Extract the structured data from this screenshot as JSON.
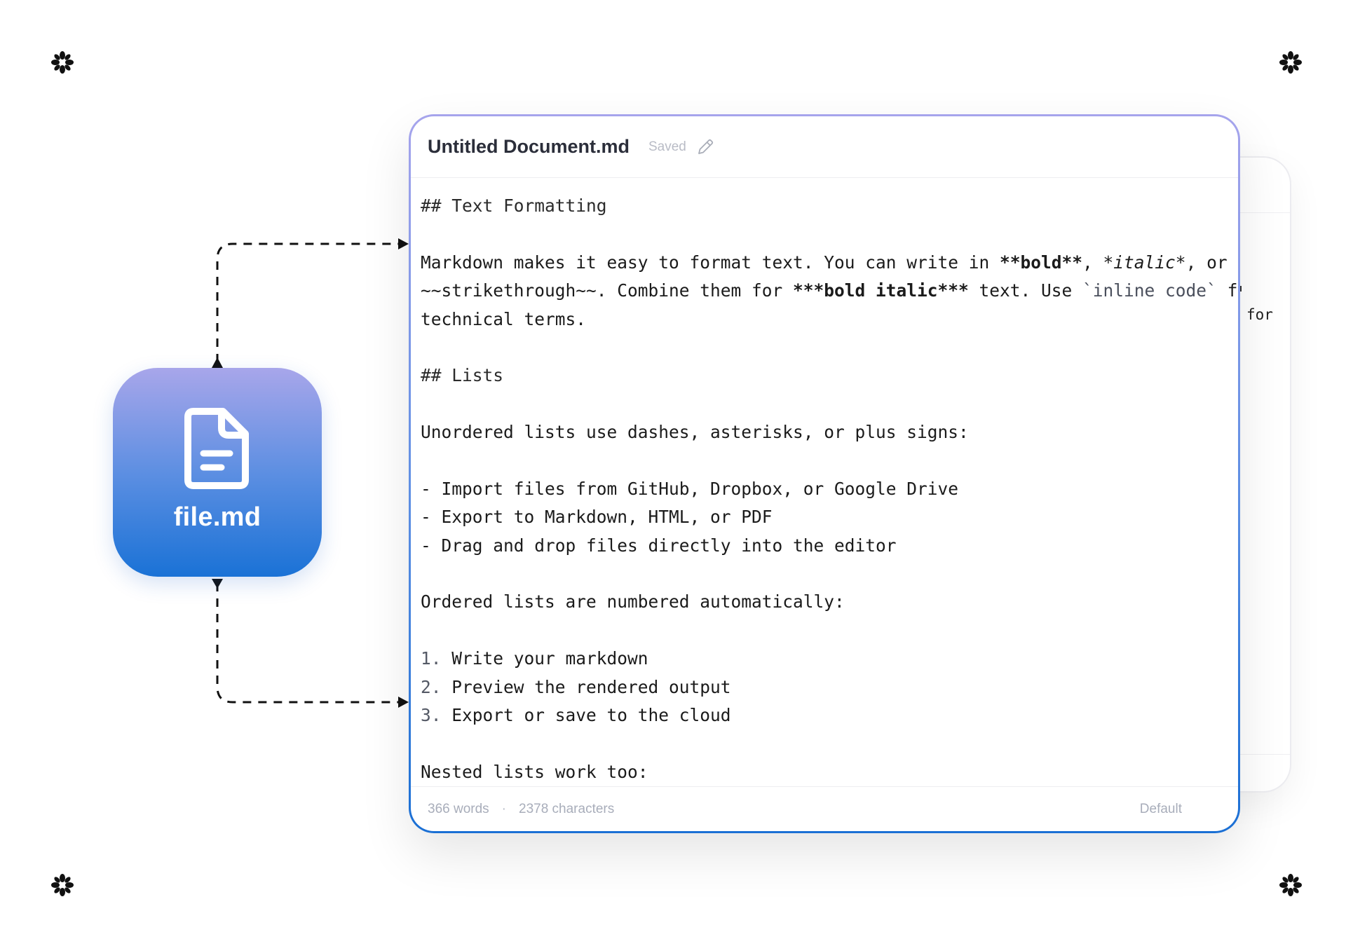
{
  "file_tile": {
    "name": "file.md",
    "icon": "document-icon"
  },
  "editor": {
    "title": "Untitled Document.md",
    "status": "Saved",
    "edit_icon": "pencil-icon",
    "lines": {
      "l1": "## Text Formatting",
      "l2a": "Markdown makes it easy to format text. You can write in ",
      "l2b": "**bold**",
      "l2c": ", ",
      "l2d": "*italic*",
      "l2e": ", or",
      "l3a": "~~strikethrough~~. Combine them for ",
      "l3b": "***bold italic***",
      "l3c": " text. Use ",
      "l3d": "`inline code`",
      "l3e": " for",
      "l4": "technical terms.",
      "l5": "## Lists",
      "l6": "Unordered lists use dashes, asterisks, or plus signs:",
      "l7": "- Import files from GitHub, Dropbox, or Google Drive",
      "l8": "- Export to Markdown, HTML, or PDF",
      "l9": "- Drag and drop files directly into the editor",
      "l10": "Ordered lists are numbered automatically:",
      "ol1_num": "1.",
      "ol1_text": " Write your markdown",
      "ol2_num": "2.",
      "ol2_text": " Preview the rendered output",
      "ol3_num": "3.",
      "ol3_text": " Export or save to the cloud",
      "l11": "Nested lists work too:"
    },
    "footer": {
      "words": "366 words",
      "separator": "·",
      "characters": "2378 characters",
      "theme": "Default"
    }
  },
  "ghost_window": {
    "visible_text": "for"
  },
  "colors": {
    "tile_gradient_top": "#a8a6ea",
    "tile_gradient_bottom": "#1a72d6",
    "window_border_top": "#a6a4ec",
    "window_border_bottom": "#1a6fd4"
  }
}
